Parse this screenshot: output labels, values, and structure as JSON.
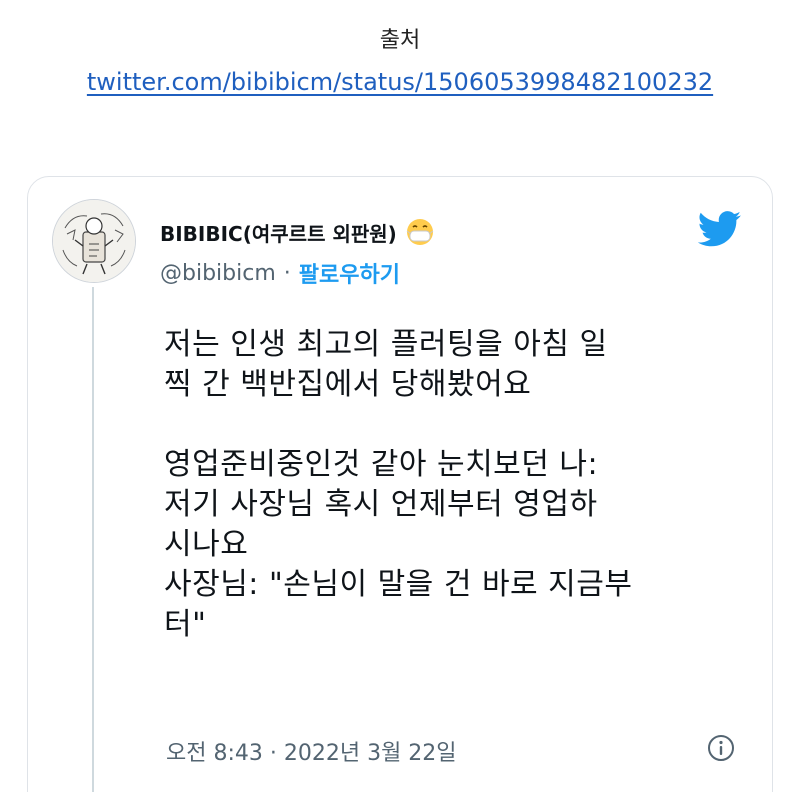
{
  "header": {
    "source_label": "출처",
    "source_link": "twitter.com/bibibicm/status/1506053998482100232"
  },
  "tweet": {
    "display_name": "BIBIBIC(여쿠르트 외판원)",
    "handle": "@bibibicm",
    "separator": "·",
    "follow_label": "팔로우하기",
    "text_lines": [
      "저는 인생 최고의 플러팅을 아침 일",
      "찍 간 백반집에서 당해봤어요",
      "영업준비중인것 같아 눈치보던 나:",
      "저기 사장님 혹시 언제부터 영업하",
      "시나요",
      "사장님: \"손님이 말을 건 바로 지금부",
      "터\""
    ],
    "timestamp": "오전 8:43 · 2022년 3월 22일",
    "icons": {
      "avatar": "avatar-illustration",
      "emoji": "face-with-medical-mask-emoji",
      "logo": "twitter-bird-icon",
      "info": "info-icon"
    },
    "colors": {
      "brand": "#1d9bf0",
      "muted": "#536471",
      "link": "#1f5fbf"
    }
  }
}
